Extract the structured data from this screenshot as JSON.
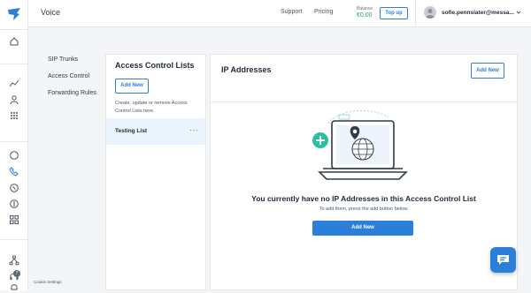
{
  "rail": {
    "icons": [
      "messagebird-logo",
      "home-icon",
      "analytics-icon",
      "contacts-icon",
      "apps-icon",
      "chat-icon",
      "voice-icon",
      "whatsapp-icon",
      "billing-icon",
      "integrations-icon",
      "flow-icon",
      "support-icon",
      "notifications-icon"
    ],
    "badge": "7"
  },
  "header": {
    "title": "Voice",
    "links": [
      "Support",
      "Pricing"
    ],
    "balance_label": "Balance",
    "balance_value": "€0.00",
    "topup_label": "Top up",
    "user_email": "sofie.pennslater@messa...",
    "colors": {
      "accent": "#2b7fd8",
      "balance": "#21a07a"
    }
  },
  "subnav": {
    "items": [
      "SIP Trunks",
      "Access Control",
      "Forwarding Rules"
    ]
  },
  "cookie_settings": "Cookie Settings",
  "acl_panel": {
    "title": "Access Control Lists",
    "add_label": "Add New",
    "description": "Create, update or remove Access Control Lists here.",
    "lists": [
      {
        "name": "Testing List",
        "menu": "···"
      }
    ]
  },
  "ip_panel": {
    "title": "IP Addresses",
    "add_label": "Add New",
    "empty_title": "You currently have no IP Addresses in this Access Control List",
    "empty_sub": "To add them, press the add button below.",
    "empty_button": "Add New"
  },
  "chat_widget": {
    "icon": "chat-bubble-icon"
  }
}
